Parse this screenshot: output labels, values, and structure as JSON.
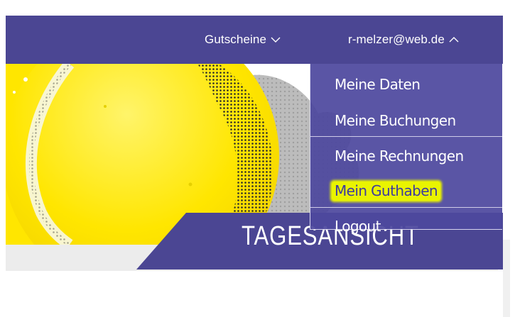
{
  "topbar": {
    "vouchers_label": "Gutscheine",
    "account_label": "r-melzer@web.de",
    "bg_color": "#4b4693"
  },
  "dropdown": {
    "items": [
      {
        "label": "Meine Daten"
      },
      {
        "label": "Meine Buchungen"
      },
      {
        "label": "Meine Rechnungen"
      },
      {
        "label": "Mein Guthaben",
        "highlighted": true
      },
      {
        "label": "Logout"
      }
    ]
  },
  "banner": {
    "title": "TAGESANSICHT"
  },
  "colors": {
    "accent": "#4b4693",
    "highlight": "#e9f400",
    "ball": "#ffe600"
  },
  "icons": {
    "vouchers_chevron": "chevron-down-icon",
    "account_chevron": "chevron-up-icon"
  }
}
